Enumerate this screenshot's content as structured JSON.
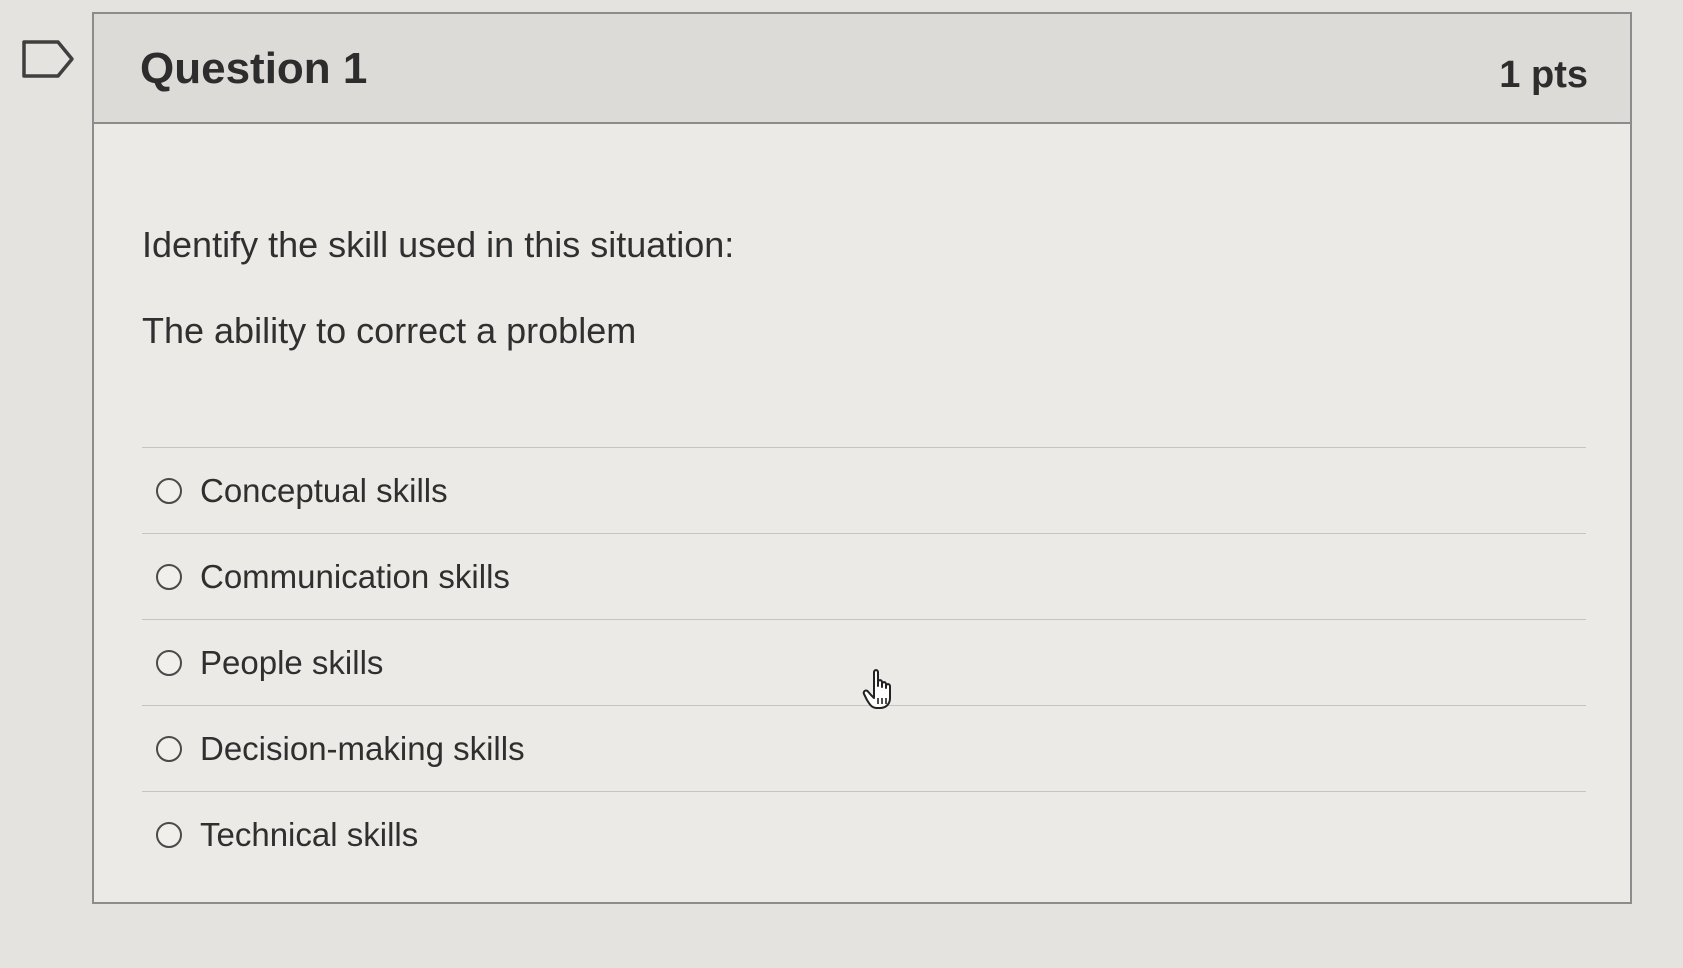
{
  "question": {
    "title": "Question 1",
    "points": "1 pts",
    "prompt": "Identify the skill used in this situation:",
    "situation": "The ability to correct a problem"
  },
  "answers": [
    {
      "label": "Conceptual skills"
    },
    {
      "label": "Communication skills"
    },
    {
      "label": "People skills"
    },
    {
      "label": "Decision-making skills"
    },
    {
      "label": "Technical skills"
    }
  ],
  "icons": {
    "flag": "flag-outline-icon",
    "cursor": "hand-pointer-cursor-icon"
  }
}
